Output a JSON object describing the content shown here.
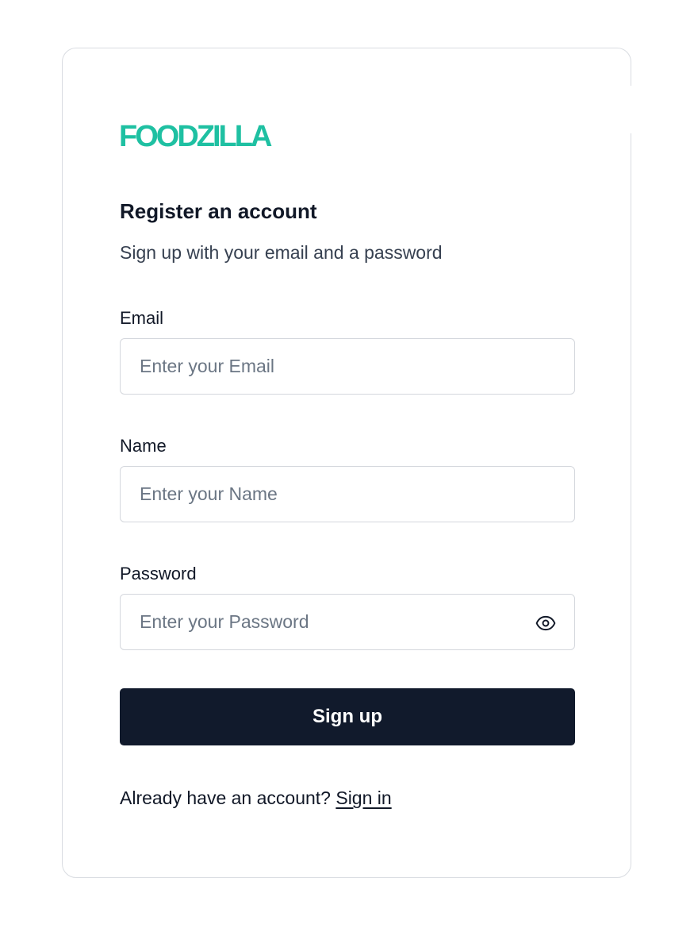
{
  "brand": {
    "name": "FOODZILLA",
    "color": "#1fc0a2"
  },
  "header": {
    "title": "Register an account",
    "subtitle": "Sign up with your email and a password"
  },
  "form": {
    "email": {
      "label": "Email",
      "placeholder": "Enter your Email",
      "value": ""
    },
    "name": {
      "label": "Name",
      "placeholder": "Enter your Name",
      "value": ""
    },
    "password": {
      "label": "Password",
      "placeholder": "Enter your Password",
      "value": "",
      "toggle_icon": "eye-icon"
    },
    "submit_label": "Sign up",
    "submit_color": "#111a2c"
  },
  "footer": {
    "prompt": "Already have an account?",
    "link_label": "Sign in"
  }
}
